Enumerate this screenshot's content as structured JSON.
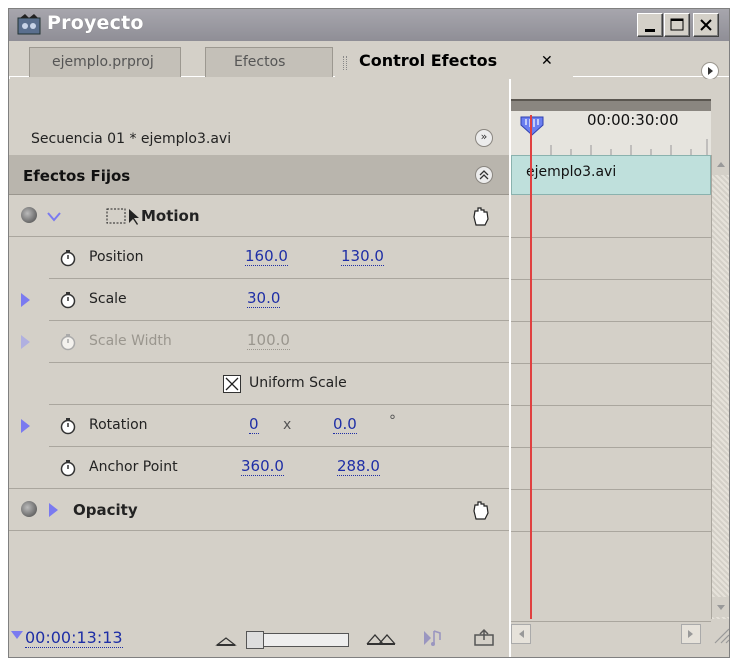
{
  "window": {
    "title": "Proyecto"
  },
  "tabs": [
    {
      "label": "ejemplo.prproj",
      "active": false
    },
    {
      "label": "Efectos",
      "active": false
    },
    {
      "label": "Control Efectos",
      "active": true
    }
  ],
  "panel": {
    "sequence_label": "Secuencia 01 * ejemplo3.avi",
    "section_header": "Efectos Fijos",
    "effects": [
      {
        "name": "Motion",
        "expanded": true,
        "properties": [
          {
            "name": "Position",
            "values": [
              "160.0",
              "130.0"
            ],
            "dim": false,
            "expandable": false
          },
          {
            "name": "Scale",
            "values": [
              "30.0"
            ],
            "dim": false,
            "expandable": true
          },
          {
            "name": "Scale Width",
            "values": [
              "100.0"
            ],
            "dim": true,
            "expandable": true
          },
          {
            "name": "Rotation",
            "values": [
              "0",
              "0.0"
            ],
            "separator": "x",
            "unit": "°",
            "dim": false,
            "expandable": true
          },
          {
            "name": "Anchor Point",
            "values": [
              "360.0",
              "288.0"
            ],
            "dim": false,
            "expandable": false
          }
        ],
        "uniform_scale": {
          "label": "Uniform Scale",
          "checked": true
        }
      },
      {
        "name": "Opacity",
        "expanded": false
      }
    ],
    "current_time": "00:00:13:13"
  },
  "timeline": {
    "timecode": "00:00:30:00",
    "clip_name": "ejemplo3.avi"
  },
  "colors": {
    "accent_blue": "#1f2fa6",
    "clip_teal": "#bfe0dc",
    "playhead_red": "#e04040",
    "panel_gray": "#d4d0c8"
  }
}
